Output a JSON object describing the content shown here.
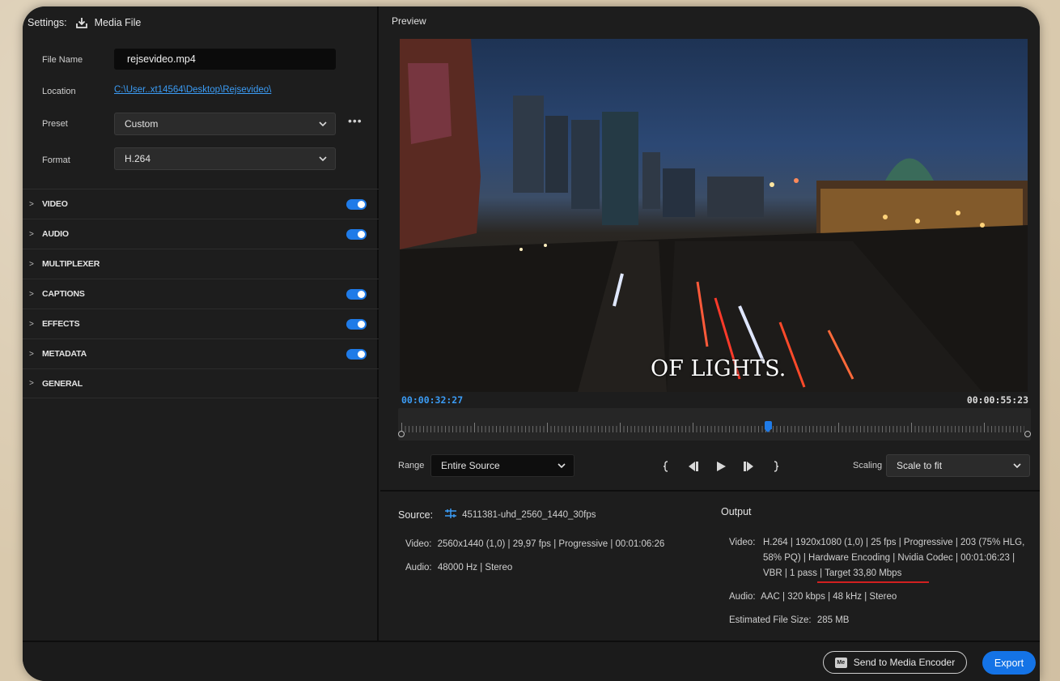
{
  "settings": {
    "title": "Settings:",
    "destination": "Media File",
    "file_name_label": "File Name",
    "file_name_value": "rejsevideo.mp4",
    "location_label": "Location",
    "location_value": "C:\\User..xt14564\\Desktop\\Rejsevideo\\",
    "preset_label": "Preset",
    "preset_value": "Custom",
    "format_label": "Format",
    "format_value": "H.264",
    "more_label": "•••"
  },
  "sections": [
    {
      "label": "VIDEO",
      "enabled": true
    },
    {
      "label": "AUDIO",
      "enabled": true
    },
    {
      "label": "MULTIPLEXER",
      "enabled": false
    },
    {
      "label": "CAPTIONS",
      "enabled": true
    },
    {
      "label": "EFFECTS",
      "enabled": true
    },
    {
      "label": "METADATA",
      "enabled": true
    },
    {
      "label": "GENERAL",
      "enabled": false
    }
  ],
  "preview": {
    "title": "Preview",
    "subtitle_text": "OF LIGHTS.",
    "current_time": "00:00:32:27",
    "end_time": "00:00:55:23",
    "playhead_fraction": 0.586,
    "range_label": "Range",
    "range_value": "Entire Source",
    "scaling_label": "Scaling",
    "scaling_value": "Scale to fit"
  },
  "source": {
    "title": "Source:",
    "name": "4511381-uhd_2560_1440_30fps",
    "video_key": "Video:",
    "video_value": "2560x1440 (1,0)  |  29,97 fps  |  Progressive  |  00:01:06:26",
    "audio_key": "Audio:",
    "audio_value": "48000 Hz  |  Stereo"
  },
  "output": {
    "title": "Output",
    "video_key": "Video:",
    "video_line1": "H.264  |  1920x1080 (1,0)  |  25 fps  |  Progressive  |  203 (75% HLG,",
    "video_line2": "58% PQ)  |  Hardware Encoding  |  Nvidia Codec  |  00:01:06:23  |",
    "video_line3": "VBR  |  1 pass  |  Target 33,80 Mbps",
    "audio_key": "Audio:",
    "audio_value": "AAC  |  320 kbps  |  48 kHz  |  Stereo",
    "size_key": "Estimated File Size:",
    "size_value": "285 MB"
  },
  "footer": {
    "encoder_icon": "Me",
    "encoder_label": "Send to Media Encoder",
    "export_label": "Export"
  },
  "colors": {
    "accent": "#1473e6",
    "link": "#3b9cf5",
    "annotation_underline": "#d22020"
  }
}
